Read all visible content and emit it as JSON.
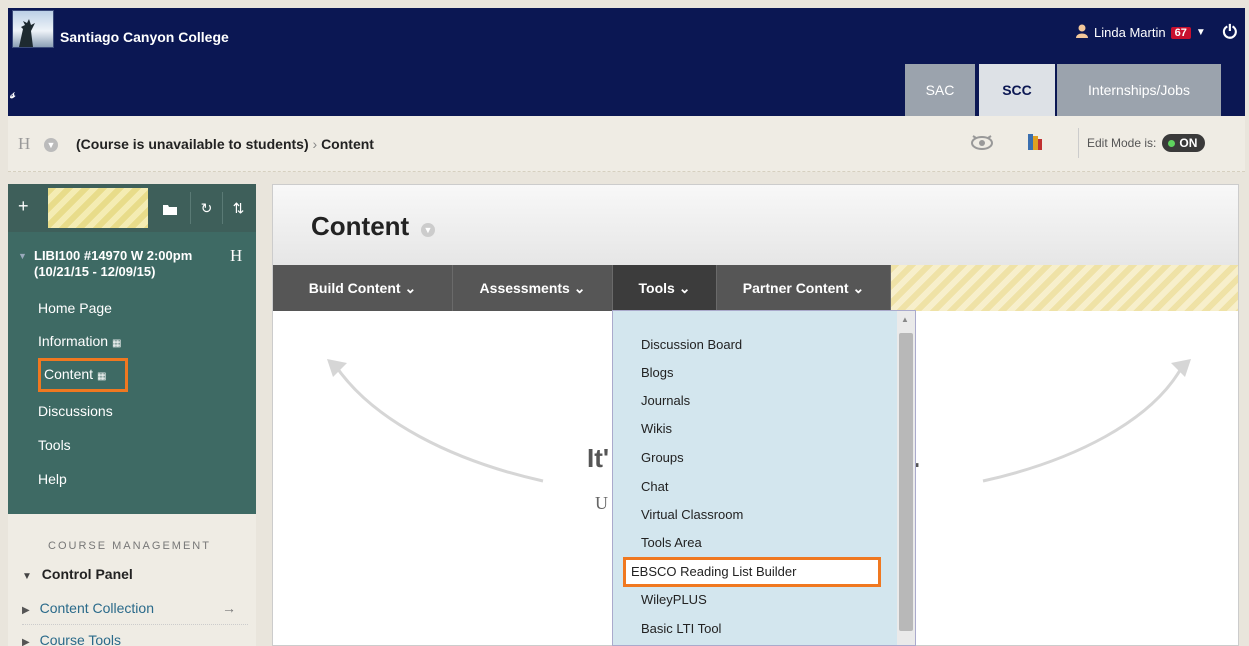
{
  "header": {
    "college_name": "Santiago Canyon College",
    "pin_glyph": "𝓈",
    "user_name": "Linda Martin",
    "user_badge": "67",
    "tabs": [
      {
        "label": "SAC"
      },
      {
        "label": "SCC"
      },
      {
        "label": "Internships/Jobs"
      }
    ]
  },
  "breadcrumb": {
    "h_glyph": "H",
    "course_status": "(Course is unavailable to students)",
    "separator": "›",
    "page": "Content",
    "edit_mode_label": "Edit Mode is:",
    "edit_mode_value": "ON"
  },
  "sidebar": {
    "course_title": "LIBI100 #14970 W 2:00pm (10/21/15 - 12/09/15)",
    "course_h": "H",
    "items": [
      {
        "label": "Home Page"
      },
      {
        "label": "Information"
      },
      {
        "label": "Content"
      },
      {
        "label": "Discussions"
      },
      {
        "label": "Tools"
      },
      {
        "label": "Help"
      }
    ],
    "management_title": "COURSE MANAGEMENT",
    "control_panel": "Control Panel",
    "mgmt_links": [
      {
        "label": "Content Collection"
      },
      {
        "label": "Course Tools"
      }
    ]
  },
  "main": {
    "title": "Content",
    "actions": [
      {
        "label": "Build Content"
      },
      {
        "label": "Assessments"
      },
      {
        "label": "Tools"
      },
      {
        "label": "Partner Content"
      }
    ],
    "empty_message_partial": "It'",
    "empty_message_end": ".",
    "empty_sub_partial": "U"
  },
  "dropdown": {
    "items": [
      {
        "label": "Discussion Board"
      },
      {
        "label": "Blogs"
      },
      {
        "label": "Journals"
      },
      {
        "label": "Wikis"
      },
      {
        "label": "Groups"
      },
      {
        "label": "Chat"
      },
      {
        "label": "Virtual Classroom"
      },
      {
        "label": "Tools Area"
      },
      {
        "label": "EBSCO Reading List Builder"
      },
      {
        "label": "WileyPLUS"
      },
      {
        "label": "Basic LTI Tool"
      }
    ]
  },
  "colors": {
    "header_bg": "#0b1753",
    "sidebar_bg": "#3e6a64",
    "highlight": "#f07820",
    "dropdown_bg": "#d3e6ee"
  }
}
